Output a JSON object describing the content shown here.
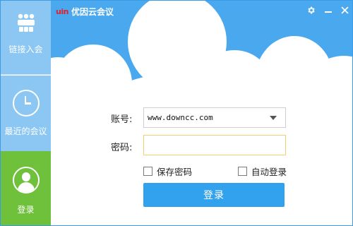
{
  "app": {
    "logo_text": "uin",
    "title": "优因云会议"
  },
  "window_controls": {
    "settings_icon": "gear-icon",
    "minimize_icon": "minimize-icon",
    "close_icon": "close-icon"
  },
  "sidebar": {
    "items": [
      {
        "id": "join",
        "label": "链接入会",
        "icon": "people-meeting-icon"
      },
      {
        "id": "recent",
        "label": "最近的会议",
        "icon": "clock-icon"
      },
      {
        "id": "login",
        "label": "登录",
        "icon": "user-icon",
        "active": true
      }
    ]
  },
  "form": {
    "account_label": "账号:",
    "account_value": "www.downcc.com",
    "password_label": "密码:",
    "password_value": "",
    "remember_label": "保存密码",
    "autologin_label": "自动登录",
    "submit_label": "登录"
  },
  "colors": {
    "sky": "#4aa8ef",
    "sidebar": "#8bc7f2",
    "active": "#6fc03a",
    "button": "#32a2ee",
    "logo": "#e0202a"
  }
}
